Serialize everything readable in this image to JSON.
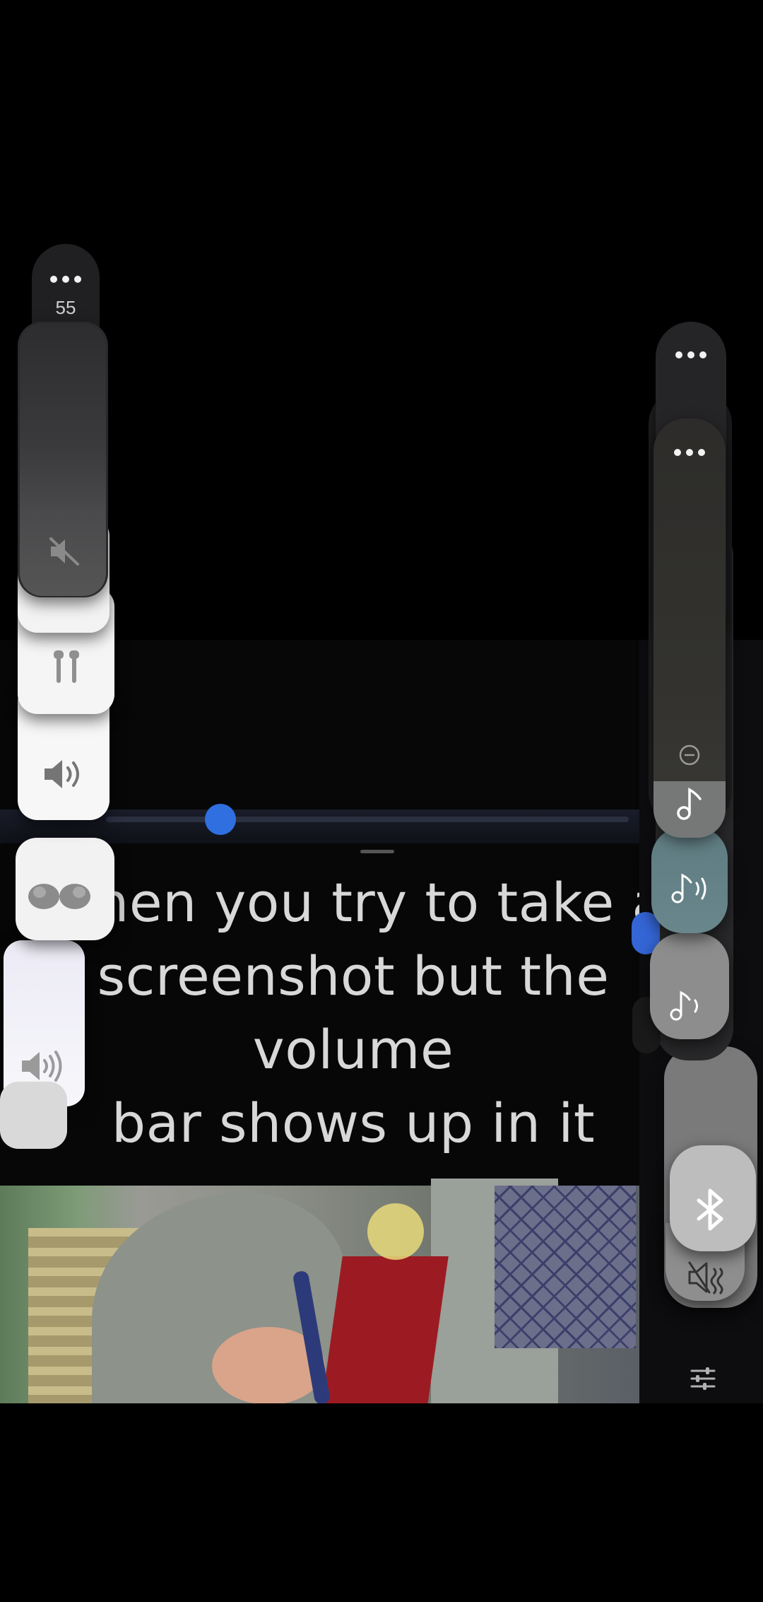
{
  "meme": {
    "caption_lines": [
      "When you try to take a",
      "screenshot but the volume",
      "bar shows up in it"
    ]
  },
  "left_panel": {
    "volume_value": "55",
    "more_icon": "more-horizontal-icon",
    "mute_icon": "speaker-muted-icon",
    "earbuds_icon": "earbuds-icon",
    "speaker_icon": "speaker-icon",
    "buds_icon": "galaxy-buds-icon",
    "speaker_loud_icon": "speaker-loud-icon"
  },
  "right_panel": {
    "more_icon": "more-horizontal-icon",
    "minus_icon": "minus-circle-icon",
    "music_icon": "music-note-icon",
    "music_volume_icon": "music-volume-icon",
    "bluetooth_icon": "bluetooth-icon",
    "mute_icon": "speaker-muted-icon",
    "equalizer_icon": "equalizer-icon"
  },
  "colors": {
    "background": "#000000",
    "accent_blue": "#3566d6",
    "teal_panel": "#5f7c82"
  }
}
